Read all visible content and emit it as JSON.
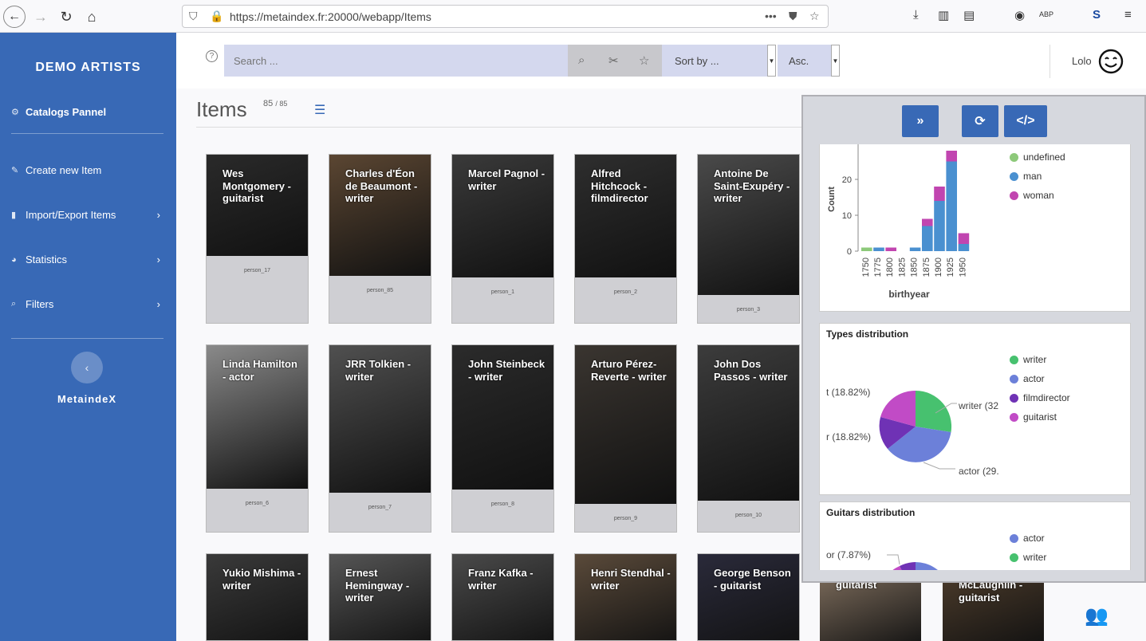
{
  "browser": {
    "url": "https://metaindex.fr:20000/webapp/Items"
  },
  "sidebar": {
    "brand": "DEMO ARTISTS",
    "items": [
      {
        "label": "Catalogs Pannel"
      },
      {
        "label": "Create new Item"
      },
      {
        "label": "Import/Export Items"
      },
      {
        "label": "Statistics"
      },
      {
        "label": "Filters"
      }
    ],
    "logo": "MetaindeX"
  },
  "topbar": {
    "search_placeholder": "Search ...",
    "sort_label": "Sort by ...",
    "order_label": "Asc.",
    "user_name": "Lolo",
    "help": "?"
  },
  "items": {
    "title": "Items",
    "count_shown": "85",
    "count_total": "/ 85",
    "cards": [
      {
        "name": "Wes Montgomery - guitarist",
        "id": "person_17"
      },
      {
        "name": "Charles d'Éon de Beaumont - writer",
        "id": "person_85"
      },
      {
        "name": "Marcel Pagnol - writer",
        "id": "person_1"
      },
      {
        "name": "Alfred Hitchcock - filmdirector",
        "id": "person_2"
      },
      {
        "name": "Antoine De Saint-Exupéry - writer",
        "id": "person_3"
      },
      {
        "name": "Linda Hamilton - actor",
        "id": "person_6"
      },
      {
        "name": "JRR Tolkien - writer",
        "id": "person_7"
      },
      {
        "name": "John Steinbeck - writer",
        "id": "person_8"
      },
      {
        "name": "Arturo Pérez-Reverte - writer",
        "id": "person_9"
      },
      {
        "name": "John Dos Passos - writer",
        "id": "person_10"
      },
      {
        "name": "Yukio Mishima - writer",
        "id": ""
      },
      {
        "name": "Ernest Hemingway - writer",
        "id": ""
      },
      {
        "name": "Franz Kafka - writer",
        "id": ""
      },
      {
        "name": "Henri Stendhal - writer",
        "id": ""
      },
      {
        "name": "George Benson - guitarist",
        "id": ""
      },
      {
        "name": "guitarist",
        "id": ""
      },
      {
        "name": "McLaughlin - guitarist",
        "id": ""
      }
    ]
  },
  "stats_panel": {
    "buttons": [
      "expand",
      "refresh",
      "code"
    ],
    "charts": [
      {
        "title": "",
        "legend": [
          "undefined",
          "man",
          "woman"
        ],
        "colors": {
          "undefined": "#8dc97a",
          "man": "#4a90d0",
          "woman": "#c145b0"
        }
      },
      {
        "title": "Types distribution",
        "legend": [
          "writer",
          "actor",
          "filmdirector",
          "guitarist"
        ],
        "slice_labels": [
          "t (18.82%)",
          "r (18.82%)",
          "writer (32",
          "actor (29."
        ],
        "colors": {
          "writer": "#47c16f",
          "actor": "#6c80d9",
          "filmdirector": "#6f32b5",
          "guitarist": "#c14bc6"
        }
      },
      {
        "title": "Guitars distribution",
        "legend": [
          "actor",
          "writer"
        ],
        "slice_labels": [
          "or (7.87%)"
        ]
      }
    ]
  },
  "chart_data": {
    "type": "bar",
    "stacked": true,
    "categories": [
      "1750",
      "1775",
      "1800",
      "1825",
      "1850",
      "1875",
      "1900",
      "1925",
      "1950"
    ],
    "series": [
      {
        "name": "undefined",
        "values": [
          1,
          0,
          0,
          0,
          0,
          0,
          0,
          0,
          0
        ]
      },
      {
        "name": "man",
        "values": [
          0,
          1,
          0,
          0,
          1,
          7,
          14,
          25,
          2
        ]
      },
      {
        "name": "woman",
        "values": [
          0,
          0,
          1,
          0,
          0,
          2,
          4,
          3,
          3
        ]
      }
    ],
    "xlabel": "birthyear",
    "ylabel": "Count",
    "yticks": [
      0,
      10,
      20
    ],
    "ylim": [
      0,
      30
    ]
  }
}
